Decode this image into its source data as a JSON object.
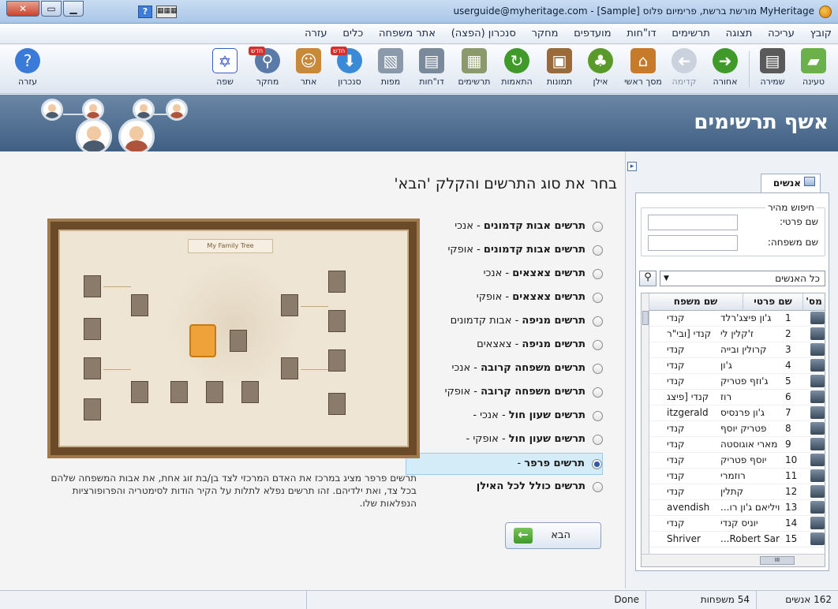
{
  "window": {
    "title": "MyHeritage מורשת ברשת, פרימיום פלוס [Sample] - userguide@myheritage.com"
  },
  "menu": [
    "קובץ",
    "עריכה",
    "תצוגה",
    "תרשימים",
    "דו\"חות",
    "מועדפים",
    "מחקר",
    "סנכרון (הפצה)",
    "אתר משפחה",
    "כלים",
    "עזרה"
  ],
  "toolbar": {
    "new_badge": "חדש",
    "items": [
      {
        "label": "טעינה",
        "icon": "folder-open-icon",
        "color": "#6bb04a"
      },
      {
        "label": "שמירה",
        "icon": "save-disk-icon",
        "color": "#5a5a5a"
      },
      {
        "label": "אחורה",
        "icon": "back-arrow-icon",
        "color": "#3f9a2a"
      },
      {
        "label": "קדימה",
        "icon": "forward-arrow-icon",
        "color": "#9aa6b4"
      },
      {
        "label": "מסך ראשי",
        "icon": "home-icon",
        "color": "#c77a2a"
      },
      {
        "label": "אילן",
        "icon": "tree-icon",
        "color": "#5a9a2a"
      },
      {
        "label": "תמונות",
        "icon": "photos-icon",
        "color": "#9a6a3a"
      },
      {
        "label": "התאמות",
        "icon": "matches-icon",
        "color": "#3f9a2a"
      },
      {
        "label": "תרשימים",
        "icon": "charts-icon",
        "color": "#8a9a6a"
      },
      {
        "label": "דו\"חות",
        "icon": "reports-icon",
        "color": "#7a8a9a"
      },
      {
        "label": "מפות",
        "icon": "maps-icon",
        "color": "#8a9aaa"
      },
      {
        "label": "סנכרון",
        "icon": "sync-icon",
        "color": "#3a8ad8"
      },
      {
        "label": "אתר",
        "icon": "family-site-icon",
        "color": "#c78a3a"
      },
      {
        "label": "מחקר",
        "icon": "research-icon",
        "color": "#5a7aa8"
      },
      {
        "label": "שפה",
        "icon": "language-flag-icon",
        "color": "#3a5ac8"
      },
      {
        "label": "עזרה",
        "icon": "help-icon",
        "color": "#3a7ad8"
      }
    ]
  },
  "banner": {
    "title": "אשף תרשימים"
  },
  "wizard": {
    "heading": "בחר את סוג התרשים והקלק 'הבא'",
    "options": [
      {
        "label": "תרשים אבות קדמונים",
        "suffix": " - אנכי",
        "selected": false
      },
      {
        "label": "תרשים אבות קדמונים",
        "suffix": " - אופקי",
        "selected": false
      },
      {
        "label": "תרשים צאצאים",
        "suffix": " - אנכי",
        "selected": false
      },
      {
        "label": "תרשים צאצאים",
        "suffix": " - אופקי",
        "selected": false
      },
      {
        "label": "תרשים מניפה",
        "suffix": " - אבות קדמונים",
        "selected": false
      },
      {
        "label": "תרשים מניפה",
        "suffix": " - צאצאים",
        "selected": false
      },
      {
        "label": "תרשים משפחה קרובה",
        "suffix": " - אנכי",
        "selected": false
      },
      {
        "label": "תרשים משפחה קרובה",
        "suffix": " - אופקי",
        "selected": false
      },
      {
        "label": "תרשים שעון חול",
        "suffix": " - אנכי -",
        "selected": false
      },
      {
        "label": "תרשים שעון חול",
        "suffix": " - אופקי -",
        "selected": false
      },
      {
        "label": "תרשים פרפר",
        "suffix": " -",
        "selected": true
      },
      {
        "label": "תרשים כולל לכל האילן",
        "suffix": "",
        "selected": false
      }
    ],
    "description": "תרשים פרפר מציג במרכז את האדם המרכזי לצד בן/בת זוג אחת, את אבות המשפחה שלהם בכל צד, ואת ילדיהם. זהו תרשים נפלא לתלות על הקיר הודות לסימטריה והפרופורציות הנפלאות שלו.",
    "preview_title": "My Family Tree",
    "next_label": "הבא"
  },
  "panel": {
    "tab": "אנשים",
    "quick_search": "חיפוש מהיר",
    "first_name_label": "שם פרטי:",
    "last_name_label": "שם משפחה:",
    "first_name_value": "",
    "last_name_value": "",
    "filter": "כל האנשים",
    "columns": [
      "מס'",
      "שם פרטי",
      "שם משפח"
    ],
    "rows": [
      {
        "no": "1",
        "first": "ג'ון פיצג'רלד",
        "last": "קנדי"
      },
      {
        "no": "2",
        "first": "ז'קלין לי",
        "last": "קנדי [ובי\"ר"
      },
      {
        "no": "3",
        "first": "קרולין ובייה",
        "last": "קנדי"
      },
      {
        "no": "4",
        "first": "ג'ון",
        "last": "קנדי"
      },
      {
        "no": "5",
        "first": "ג'וזף פטריק",
        "last": "קנדי"
      },
      {
        "no": "6",
        "first": "רוז",
        "last": "קנדי [פיצג"
      },
      {
        "no": "7",
        "first": "ג'ון פרנסיס",
        "last": "itzgerald"
      },
      {
        "no": "8",
        "first": "פטריק יוסף",
        "last": "קנדי"
      },
      {
        "no": "9",
        "first": "מארי אוגוסטה",
        "last": "קנדי"
      },
      {
        "no": "10",
        "first": "יוסף פטריק",
        "last": "קנדי"
      },
      {
        "no": "11",
        "first": "רוזמרי",
        "last": "קנדי"
      },
      {
        "no": "12",
        "first": "קתלין",
        "last": "קנדי"
      },
      {
        "no": "13",
        "first": "ויליאם ג'ון רו...",
        "last": "avendish"
      },
      {
        "no": "14",
        "first": "יוניס קנדי",
        "last": "קנדי"
      },
      {
        "no": "15",
        "first": "Robert Sar...",
        "last": "Shriver"
      }
    ]
  },
  "status": {
    "people": "162 אנשים",
    "families": "54 משפחות",
    "state": "Done"
  }
}
